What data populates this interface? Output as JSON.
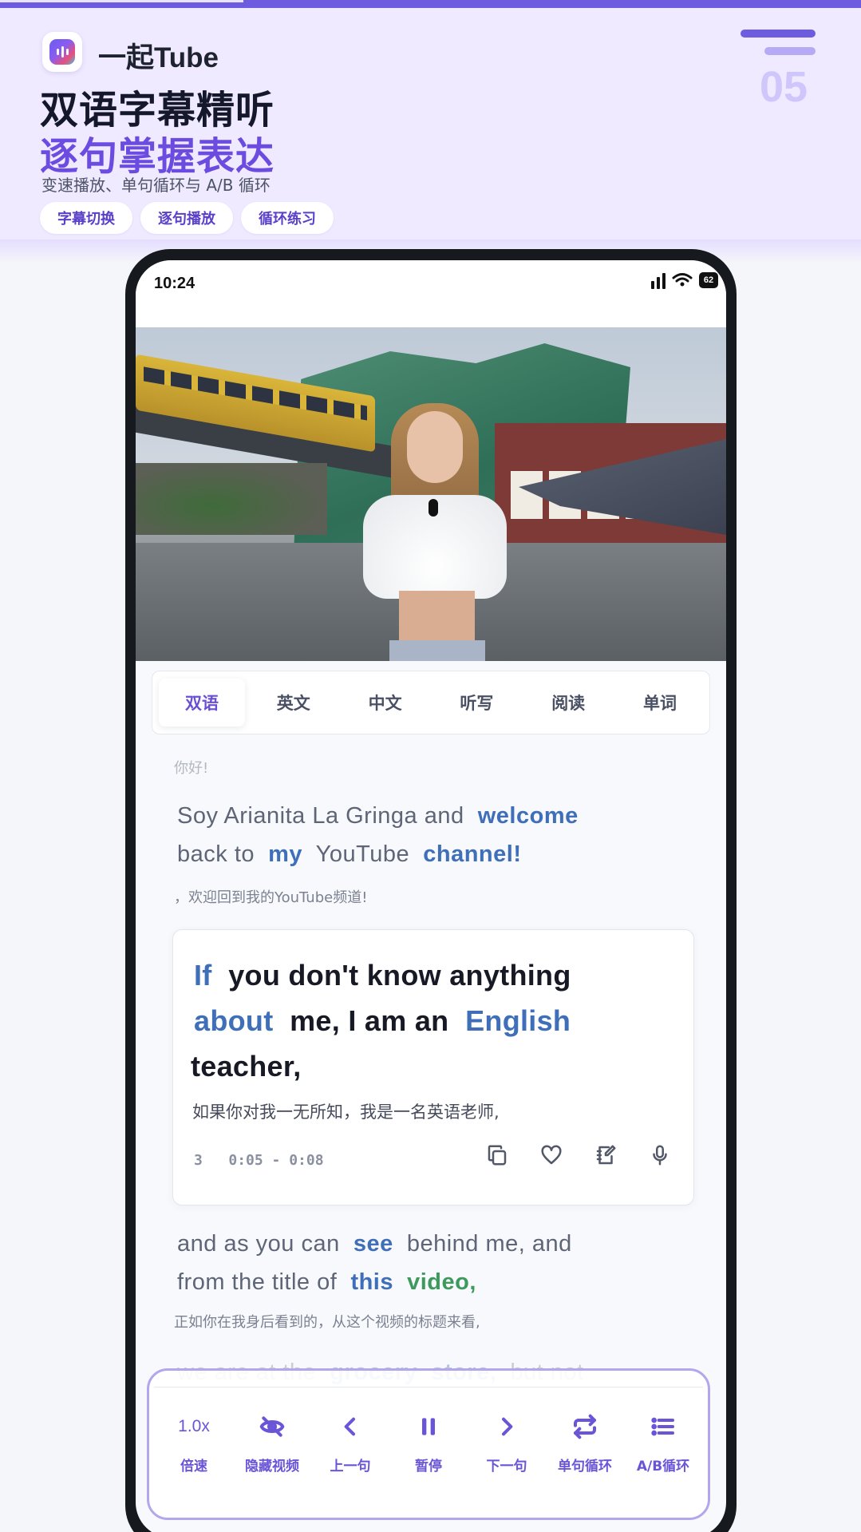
{
  "promo": {
    "app_name": "一起Tube",
    "headline_1": "双语字幕精听",
    "headline_2": "逐句掌握表达",
    "subhead": "变速播放、单句循环与 A/B 循环",
    "chips": [
      "字幕切换",
      "逐句播放",
      "循环练习"
    ],
    "step_number": "05",
    "accent_color": "#6c4ce0"
  },
  "status_bar": {
    "time": "10:24",
    "battery": "62"
  },
  "tabs": [
    {
      "label": "双语",
      "active": true
    },
    {
      "label": "英文",
      "active": false
    },
    {
      "label": "中文",
      "active": false
    },
    {
      "label": "听写",
      "active": false
    },
    {
      "label": "阅读",
      "active": false
    },
    {
      "label": "单词",
      "active": false
    }
  ],
  "subtitles": {
    "prev_zh": "你好!",
    "line2_en": {
      "w1": "Soy Arianita La Gringa and",
      "w2": "welcome",
      "w3": "back to",
      "w4": "my",
      "w5": "YouTube",
      "w6": "channel!"
    },
    "line2_zh": "，欢迎回到我的YouTube频道!",
    "current": {
      "w1": "If",
      "w2": "you don't know anything",
      "w3": "about",
      "w4": "me, I am an",
      "w5": "English",
      "w6": "teacher,",
      "zh": "如果你对我一无所知，我是一名英语老师,",
      "index": "3",
      "time_range": "0:05 - 0:08"
    },
    "line4_en": {
      "w1": "and as you can",
      "w2": "see",
      "w3": "behind me, and",
      "w4": "from the title of",
      "w5": "this",
      "w6": "video,"
    },
    "line4_zh": "正如你在我身后看到的，从这个视频的标题来看,",
    "line5_en": {
      "w1": "we are at the",
      "w2": "grocery",
      "w3": "store,",
      "w4": "but not"
    }
  },
  "controls": {
    "speed_value": "1.0x",
    "items": [
      {
        "label": "倍速",
        "icon": "speed-text"
      },
      {
        "label": "隐藏视频",
        "icon": "eye-off-icon"
      },
      {
        "label": "上一句",
        "icon": "chevron-left-icon"
      },
      {
        "label": "暂停",
        "icon": "pause-icon"
      },
      {
        "label": "下一句",
        "icon": "chevron-right-icon"
      },
      {
        "label": "单句循环",
        "icon": "repeat-icon"
      },
      {
        "label": "A/B循环",
        "icon": "list-icon"
      }
    ]
  }
}
